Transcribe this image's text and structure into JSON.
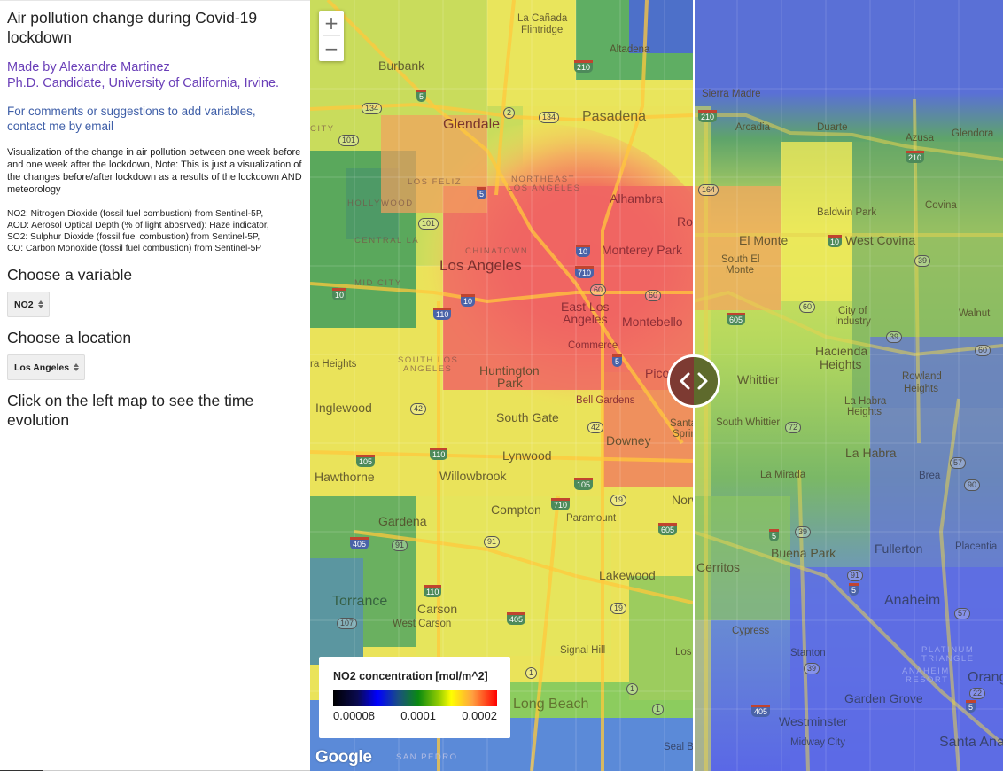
{
  "sidebar": {
    "title": "Air pollution change during Covid-19 lockdown",
    "author_line1": "Made by Alexandre Martinez",
    "author_line2": "Ph.D. Candidate, University of California, Irvine.",
    "contact_line1": "For comments or suggestions to add variables,",
    "contact_line2": "contact me by email",
    "description": "Visualization of the change in air pollution between one week before and one week after the lockdown, Note: This is just a visualization of the changes before/after lockdown as a results of the lockdown AND meteorology",
    "variables_info": [
      "NO2: Nitrogen Dioxide (fossil fuel combustion) from Sentinel-5P,",
      "AOD: Aerosol Optical Depth (% of light abosrved): Haze indicator,",
      "SO2: Sulphur Dioxide (fossil fuel combustion) from Sentinel-5P,",
      "CO: Carbon Monoxide (fossil fuel combustion) from Sentinel-5P"
    ],
    "choose_variable_label": "Choose a variable",
    "variable_select_value": "NO2",
    "choose_location_label": "Choose a location",
    "location_select_value": "Los Angeles",
    "click_instruction": "Click on the left map to see the time evolution"
  },
  "map": {
    "zoom_in": "+",
    "zoom_out": "−",
    "attribution": "Google",
    "legend": {
      "title": "NO2 concentration [mol/m^2]",
      "ticks": [
        "0.00008",
        "0.0001",
        "0.0002"
      ],
      "colors": [
        "#000000",
        "#0000ff",
        "#0a8a10",
        "#ffff00",
        "#ff0000"
      ]
    },
    "left_labels": {
      "la_canada": "La Cañada",
      "flintridge": "Flintridge",
      "altadena": "Altadena",
      "burbank": "Burbank",
      "glendale": "Glendale",
      "pasadena": "Pasadena",
      "los_feliz": "LOS FELIZ",
      "northeast": "NORTHEAST",
      "los_angeles_hood": "LOS ANGELES",
      "hollywood": "HOLLYWOOD",
      "alhambra": "Alhambra",
      "central_la": "CENTRAL LA",
      "chinatown": "CHINATOWN",
      "los_angeles": "Los Angeles",
      "monterey_park": "Monterey Park",
      "mid_city": "MID CITY",
      "east_los": "East Los",
      "angeles": "Angeles",
      "montebello": "Montebello",
      "commerce": "Commerce",
      "ra_heights": "ra Heights",
      "south_los": "SOUTH LOS",
      "angeles_hood2": "ANGELES",
      "huntington": "Huntington",
      "park": "Park",
      "pico_rivera": "Pico Rivera",
      "inglewood": "Inglewood",
      "bell_gardens": "Bell Gardens",
      "south_gate": "South Gate",
      "downey": "Downey",
      "santa_fe": "Santa Fe",
      "springs": "Springs",
      "hawthorne": "Hawthorne",
      "lynwood": "Lynwood",
      "willowbrook": "Willowbrook",
      "compton": "Compton",
      "paramount": "Paramount",
      "norwalk": "Norwalk",
      "gardena": "Gardena",
      "lakewood": "Lakewood",
      "torrance": "Torrance",
      "carson": "Carson",
      "west_carson": "West Carson",
      "signal_hill": "Signal Hill",
      "long_beach": "Long Beach",
      "los_alamitos": "Los Alamitos",
      "seal_beach": "Seal Beach",
      "san_pedro": "SAN PEDRO",
      "city": "CITY",
      "rosemead": "Rosemead"
    },
    "right_labels": {
      "sierra_madre": "Sierra Madre",
      "arcadia": "Arcadia",
      "duarte": "Duarte",
      "azusa": "Azusa",
      "glendora": "Glendora",
      "baldwin_park": "Baldwin Park",
      "covina": "Covina",
      "el_monte": "El Monte",
      "west_covina": "West Covina",
      "south_el": "South El",
      "monte": "Monte",
      "city_of": "City of",
      "industry": "Industry",
      "walnut": "Walnut",
      "hacienda": "Hacienda",
      "heights": "Heights",
      "whittier": "Whittier",
      "rowland": "Rowland",
      "rowland_heights": "Heights",
      "la_habra_h": "La Habra",
      "la_habra_h2": "Heights",
      "south_whittier": "South Whittier",
      "la_habra": "La Habra",
      "la_mirada": "La Mirada",
      "brea": "Brea",
      "buena_park": "Buena Park",
      "fullerton": "Fullerton",
      "placentia": "Placentia",
      "cerritos": "Cerritos",
      "anaheim": "Anaheim",
      "cypress": "Cypress",
      "stanton": "Stanton",
      "platinum": "PLATINUM",
      "triangle": "TRIANGLE",
      "anaheim_resort1": "ANAHEIM",
      "anaheim_resort2": "RESORT",
      "orange": "Orange",
      "garden_grove": "Garden Grove",
      "westminster": "Westminster",
      "midway_city": "Midway City",
      "santa_ana": "Santa Ana"
    },
    "shields": [
      "210",
      "5",
      "134",
      "2",
      "101",
      "10",
      "110",
      "710",
      "60",
      "105",
      "605",
      "405",
      "91",
      "42",
      "19",
      "107",
      "1",
      "164",
      "39",
      "57",
      "90",
      "72",
      "22"
    ]
  }
}
